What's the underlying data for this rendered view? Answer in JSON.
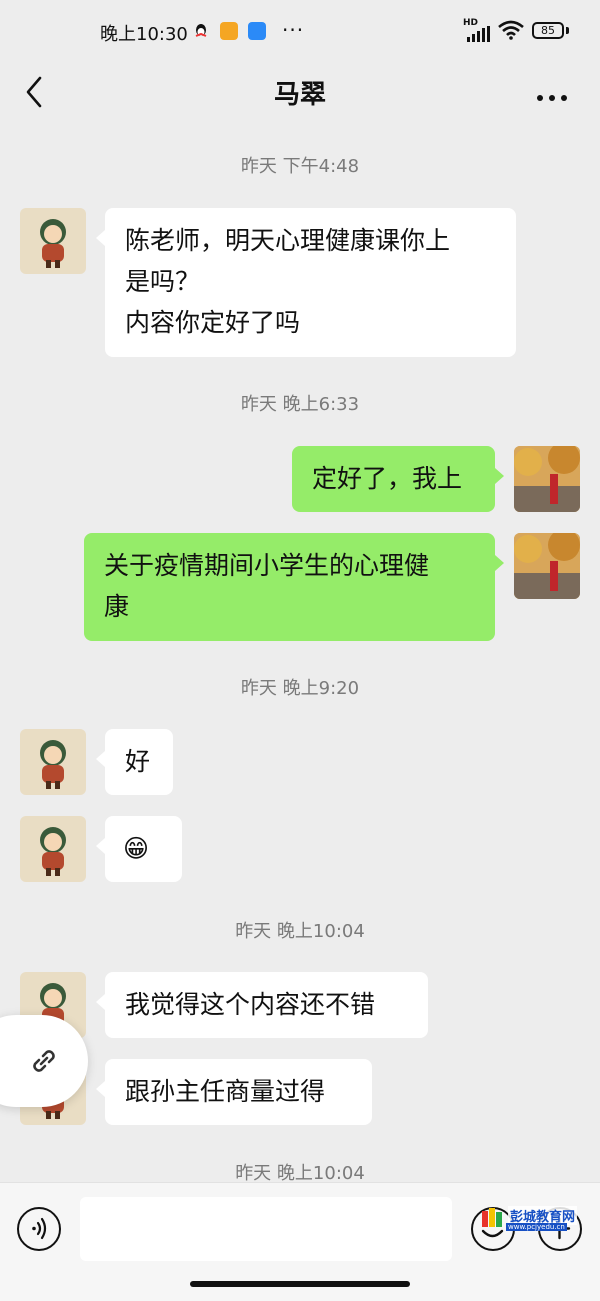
{
  "status_bar": {
    "time": "晚上10:30",
    "more": "···",
    "network": "HD",
    "battery": "85"
  },
  "nav": {
    "title": "马翠"
  },
  "messages": [
    {
      "type": "time",
      "text": "昨天 下午4:48"
    },
    {
      "type": "msg",
      "side": "left",
      "text": "陈老师，明天心理健康课你上\n是吗？\n内容你定好了吗"
    },
    {
      "type": "time",
      "text": "昨天 晚上6:33"
    },
    {
      "type": "msg",
      "side": "right",
      "text": "定好了，我上"
    },
    {
      "type": "msg",
      "side": "right",
      "text": "关于疫情期间小学生的心理健\n康"
    },
    {
      "type": "time",
      "text": "昨天 晚上9:20"
    },
    {
      "type": "msg",
      "side": "left",
      "text": "好"
    },
    {
      "type": "msg",
      "side": "left",
      "text": "😁"
    },
    {
      "type": "time",
      "text": "昨天 晚上10:04"
    },
    {
      "type": "msg",
      "side": "left",
      "text": "我觉得这个内容还不错"
    },
    {
      "type": "msg",
      "side": "left",
      "text": "跟孙主任商量过得"
    },
    {
      "type": "time",
      "text": "昨天 晚上10:04"
    }
  ],
  "input": {
    "placeholder": ""
  },
  "watermark": {
    "text": "彭城教育网",
    "url": "www.pcjyedu.cn"
  },
  "colors": {
    "background": "#ededed",
    "self_bubble": "#95ec69",
    "other_bubble": "#ffffff"
  }
}
